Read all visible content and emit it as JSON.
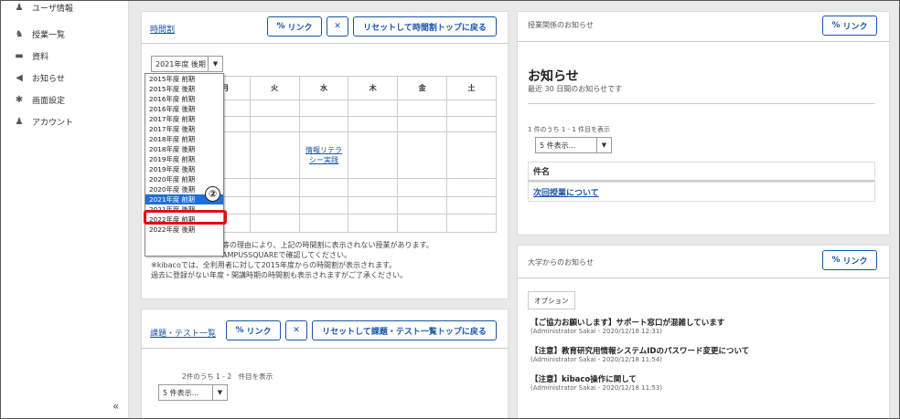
{
  "sidebar": {
    "items": [
      {
        "icon": "user-icon",
        "label": "ユーザ情報"
      },
      {
        "icon": "classes-icon",
        "label": "授業一覧"
      },
      {
        "icon": "folder-icon",
        "label": "資料"
      },
      {
        "icon": "megaphone-icon",
        "label": "お知らせ"
      },
      {
        "icon": "gear-icon",
        "label": "画面設定"
      },
      {
        "icon": "account-icon",
        "label": "アカウント"
      }
    ],
    "collapse": "«"
  },
  "timetable": {
    "title": "時間割",
    "link_btn": "リンク",
    "expand_icon": "✕",
    "reset_btn": "リセットして時間割トップに戻る",
    "selected_term": "2021年度 後期",
    "days": [
      "月",
      "火",
      "水",
      "木",
      "金",
      "土"
    ],
    "course": "情報リテラシー実践",
    "notes": [
      "等の理由により、上記の時間割に表示されない授業があります。",
      "AMPUSSQUAREで確認してください。",
      "※kibacoでは、全利用者に対して2015年度からの時間割が表示されます。",
      "過去に登録がない年度・開講時期の時間割も表示されますがご了承ください。"
    ]
  },
  "dropdown": {
    "options": [
      "2015年度 前期",
      "2015年度 後期",
      "2016年度 前期",
      "2016年度 後期",
      "2017年度 前期",
      "2017年度 後期",
      "2018年度 前期",
      "2018年度 後期",
      "2019年度 前期",
      "2019年度 後期",
      "2020年度 前期",
      "2020年度 後期",
      "2021年度 前期",
      "2021年度 後期",
      "2022年度 前期",
      "2022年度 後期"
    ],
    "highlight": "2021年度 前期",
    "marker": "②"
  },
  "assignments": {
    "title": "課題・テスト一覧",
    "link_btn": "リンク",
    "expand_icon": "✕",
    "reset_btn": "リセットして課題・テスト一覧トップに戻る",
    "count": "2件のうち 1 - 2　件目を表示",
    "page_size": "5 件表示..."
  },
  "course_notices": {
    "title": "授業関係のお知らせ",
    "link_btn": "リンク",
    "heading": "お知らせ",
    "subheading": "最近 30 日間のお知らせです",
    "count": "1 件のうち 1 - 1 件目を表示",
    "page_size": "5 件表示...",
    "col_header": "件名",
    "item": "次回授業について"
  },
  "univ_notices": {
    "title": "大学からのお知らせ",
    "link_btn": "リンク",
    "options_tab": "オプション",
    "items": [
      {
        "title": "【ご協力お願いします】サポート窓口が混雑しています",
        "meta": "(Administrator Sakai - 2020/12/18 12:31)"
      },
      {
        "title": "【注意】教育研究用情報システムIDのパスワード変更について",
        "meta": "(Administrator Sakai - 2020/12/18 11:54)"
      },
      {
        "title": "【注意】kibaco操作に関して",
        "meta": "(Administrator Sakai - 2020/12/18 11:53)"
      }
    ]
  }
}
